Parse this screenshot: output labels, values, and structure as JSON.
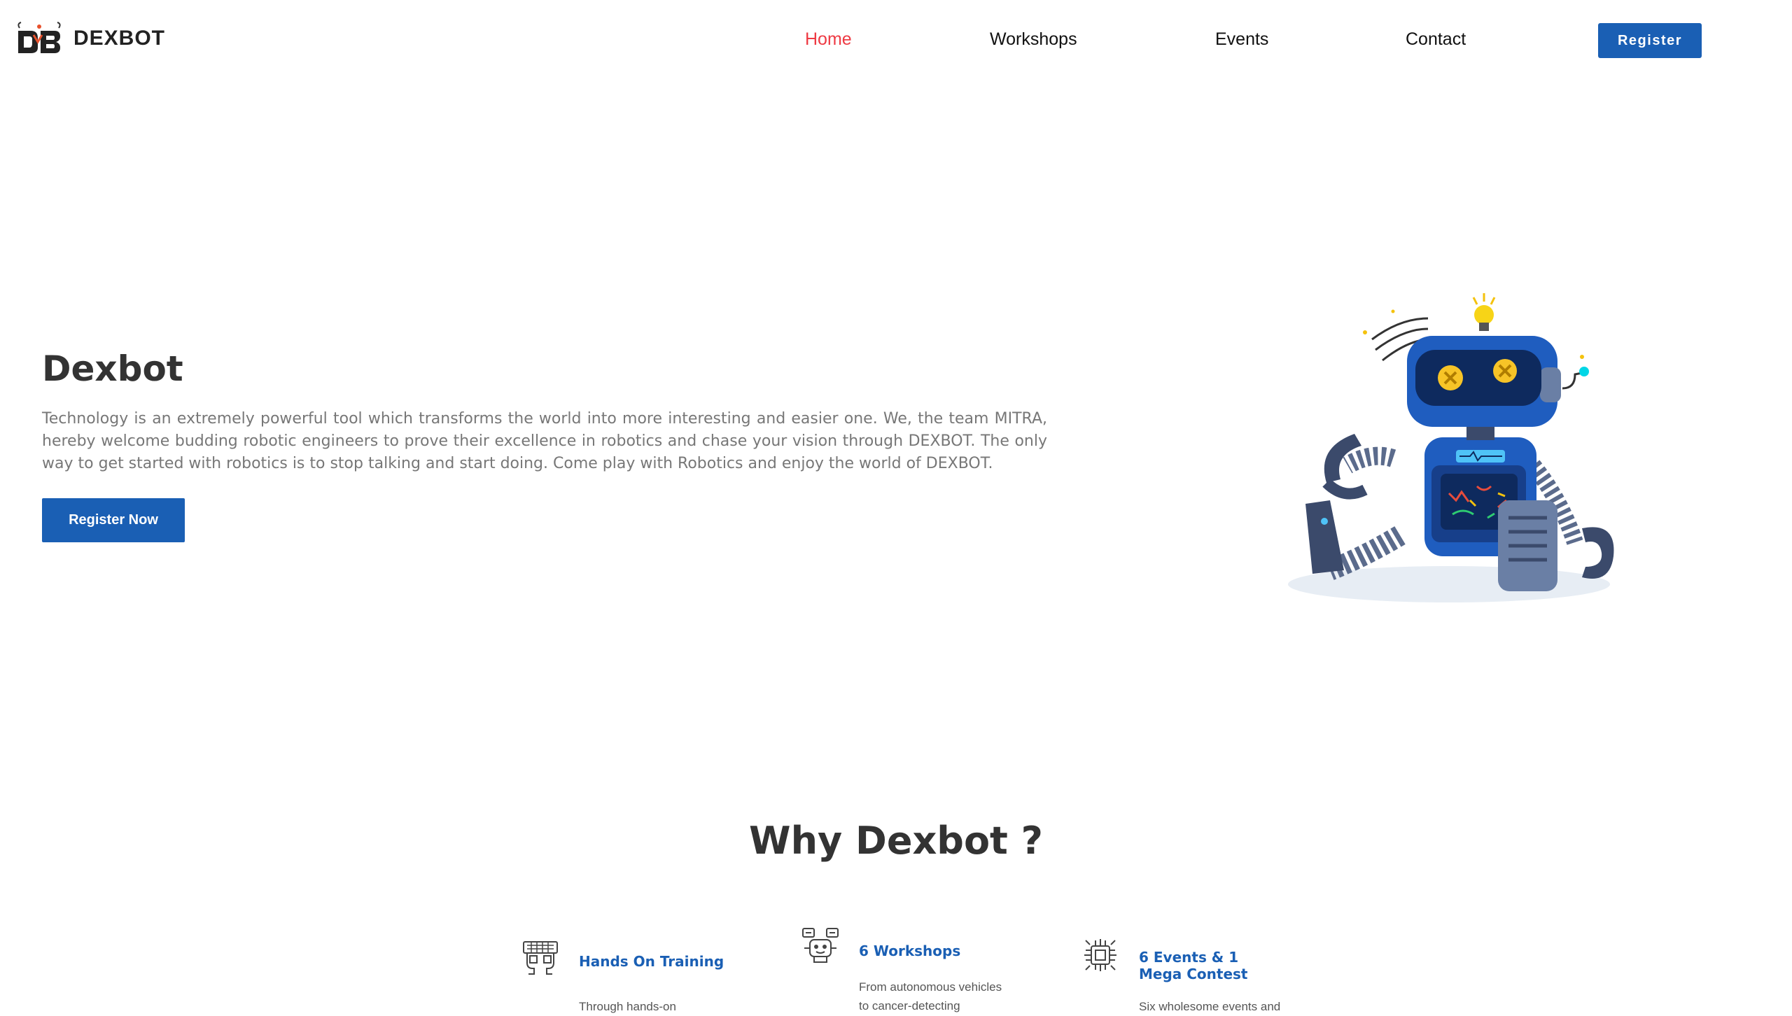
{
  "brand": {
    "name": "DEXBOT"
  },
  "nav": {
    "items": [
      {
        "label": "Home",
        "active": true
      },
      {
        "label": "Workshops"
      },
      {
        "label": "Events"
      },
      {
        "label": "Contact"
      }
    ],
    "register_label": "Register"
  },
  "hero": {
    "title": "Dexbot",
    "text": "Technology is an extremely powerful tool which transforms the world into more interesting and easier one. We, the team MITRA, hereby welcome budding robotic engineers to prove their excellence in robotics and chase your vision through DEXBOT. The only way to get started with robotics is to stop talking and start doing. Come play with Robotics and enjoy the world of DEXBOT.",
    "cta_label": "Register Now",
    "illustration": "robot-illustration"
  },
  "why": {
    "title": "Why Dexbot ?",
    "features": [
      {
        "icon": "hands-training-icon",
        "title": "Hands On Training",
        "desc": "Through hands-on"
      },
      {
        "icon": "robot-workshop-icon",
        "title": "6 Workshops",
        "desc": "From autonomous vehicles to cancer-detecting"
      },
      {
        "icon": "microchip-icon",
        "title": "6 Events & 1 Mega Contest",
        "desc": "Six wholesome events and"
      }
    ]
  },
  "colors": {
    "primary": "#1a5fb4",
    "active_nav": "#ee3a43",
    "text_muted": "#777777"
  }
}
